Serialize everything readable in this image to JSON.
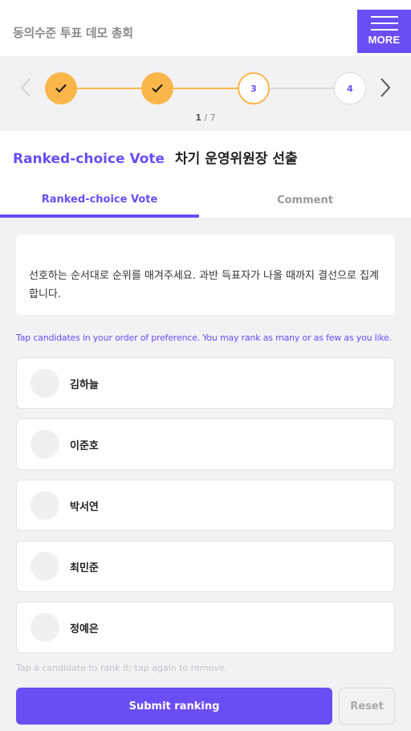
{
  "header": {
    "title": "동의수준 투표 데모 총회",
    "more_label": "MORE"
  },
  "stepper": {
    "steps": [
      {
        "label": "",
        "state": "done"
      },
      {
        "label": "",
        "state": "done"
      },
      {
        "label": "3",
        "state": "current"
      },
      {
        "label": "4",
        "state": "todo"
      }
    ],
    "page_current": "1",
    "page_separator": " / ",
    "page_total": "7"
  },
  "vote": {
    "type_label": "Ranked-choice Vote",
    "name": "차기 운영위원장 선출"
  },
  "tabs": [
    {
      "label": "Ranked-choice Vote",
      "active": true
    },
    {
      "label": "Comment",
      "active": false
    }
  ],
  "instruction": "선호하는 순서대로 순위를 매겨주세요. 과반 득표자가 나올 때까지 결선으로 집계합니다.",
  "hint": "Tap candidates in your order of preference. You may rank as many or as few as you like.",
  "candidates": [
    {
      "name": "김하늘"
    },
    {
      "name": "이준호"
    },
    {
      "name": "박서연"
    },
    {
      "name": "최민준"
    },
    {
      "name": "정예은"
    }
  ],
  "footer_hint": "Tap a candidate to rank it; tap again to remove.",
  "buttons": {
    "submit": "Submit ranking",
    "reset": "Reset"
  },
  "colors": {
    "accent": "#6b4df5",
    "step_done": "#fbb64a"
  },
  "icons": {
    "done_step": "check-icon",
    "prev": "chevron-left-icon",
    "next": "chevron-right-icon",
    "menu": "hamburger-icon"
  }
}
